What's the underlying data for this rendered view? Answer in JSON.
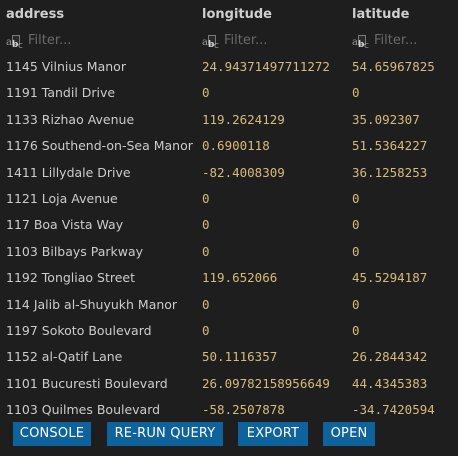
{
  "columns": {
    "address": "address",
    "longitude": "longitude",
    "latitude": "latitude"
  },
  "filter_placeholder": "Filter...",
  "rows": [
    {
      "address": "1145 Vilnius Manor",
      "longitude": "24.94371497711272",
      "latitude": "54.65967825"
    },
    {
      "address": "1191 Tandil Drive",
      "longitude": "0",
      "latitude": "0"
    },
    {
      "address": "1133 Rizhao Avenue",
      "longitude": "119.2624129",
      "latitude": "35.092307"
    },
    {
      "address": "1176 Southend-on-Sea Manor",
      "longitude": "0.6900118",
      "latitude": "51.5364227"
    },
    {
      "address": "1411 Lillydale Drive",
      "longitude": "-82.4008309",
      "latitude": "36.1258253"
    },
    {
      "address": "1121 Loja Avenue",
      "longitude": "0",
      "latitude": "0"
    },
    {
      "address": "117 Boa Vista Way",
      "longitude": "0",
      "latitude": "0"
    },
    {
      "address": "1103 Bilbays Parkway",
      "longitude": "0",
      "latitude": "0"
    },
    {
      "address": "1192 Tongliao Street",
      "longitude": "119.652066",
      "latitude": "45.5294187"
    },
    {
      "address": "114 Jalib al-Shuyukh Manor",
      "longitude": "0",
      "latitude": "0"
    },
    {
      "address": "1197 Sokoto Boulevard",
      "longitude": "0",
      "latitude": "0"
    },
    {
      "address": "1152 al-Qatif Lane",
      "longitude": "50.1116357",
      "latitude": "26.2844342"
    },
    {
      "address": "1101 Bucuresti Boulevard",
      "longitude": "26.09782158956649",
      "latitude": "44.4345383"
    },
    {
      "address": "1103 Quilmes Boulevard",
      "longitude": "-58.2507878",
      "latitude": "-34.7420594"
    }
  ],
  "buttons": {
    "console": "CONSOLE",
    "rerun": "RE-RUN QUERY",
    "export": "EXPORT",
    "open": "OPEN"
  },
  "colors": {
    "background": "#1e1e1e",
    "number": "#d7ba7d",
    "button": "#0e639c"
  }
}
